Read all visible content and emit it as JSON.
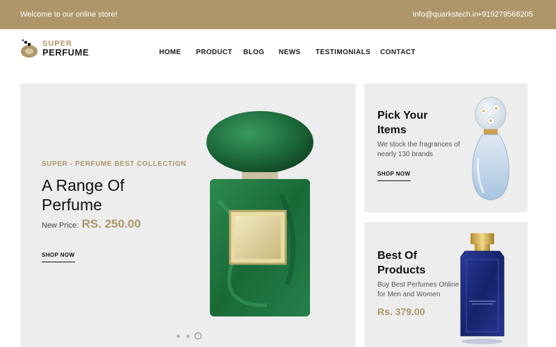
{
  "topbar": {
    "welcome": "Welcome to our online store!",
    "email": "info@quarkstech.in",
    "phone": "+919279568205",
    "background_color": "#af966a"
  },
  "brand": {
    "line1": "SUPER",
    "line2": "PERFUME",
    "accent_color": "#af966a"
  },
  "nav": {
    "items": [
      "HOME",
      "PRODUCT",
      "BLOG",
      "NEWS",
      "TESTIMONIALS",
      "CONTACT"
    ]
  },
  "hero": {
    "kicker": "SUPER - PERFUME BEST COLLECTION",
    "title": "A Range Of Perfume",
    "price_label": "New Price:",
    "price": "RS. 250.00",
    "cta": "SHOP NOW",
    "product_image": "green-perfume-bottle",
    "slider_dots": 3,
    "active_dot": 3
  },
  "promo_1": {
    "title": "Pick Your Items",
    "description": "We stock the fragrances of nearly 130 brands",
    "cta": "SHOP NOW",
    "product_image": "daisy-perfume-bottle"
  },
  "promo_2": {
    "title": "Best Of Products",
    "description": "Buy Best Perfumes Online for Men and Women",
    "price": "Rs. 379.00",
    "product_image": "blue-perfume-bottle"
  }
}
